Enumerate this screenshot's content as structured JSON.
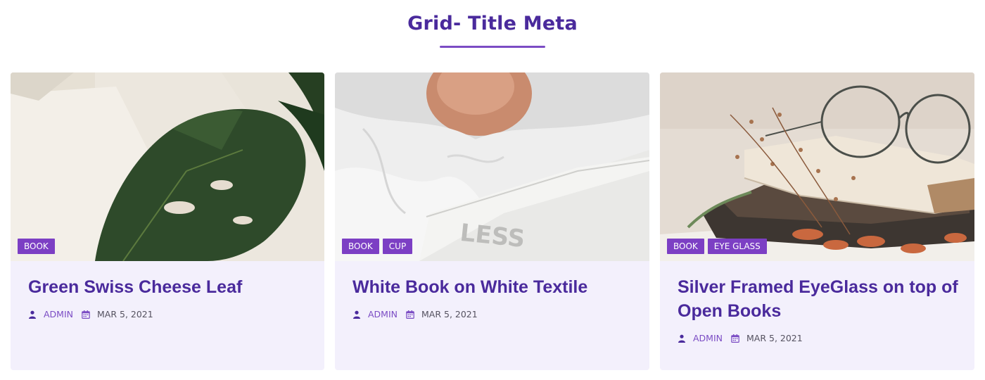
{
  "section": {
    "title": "Grid- Title Meta"
  },
  "colors": {
    "accent": "#7c3fc4",
    "title": "#4a2a9c",
    "card_bg": "#f3f0fc"
  },
  "cards": [
    {
      "image_icon": "monstera-leaf-photo",
      "tags": [
        "BOOK"
      ],
      "title": "Green Swiss Cheese Leaf",
      "author": "ADMIN",
      "date": "MAR 5, 2021",
      "author_icon": "user-icon",
      "date_icon": "calendar-icon"
    },
    {
      "image_icon": "white-book-photo",
      "image_text": "LESS",
      "tags": [
        "BOOK",
        "CUP"
      ],
      "title": "White Book on White Textile",
      "author": "ADMIN",
      "date": "MAR 5, 2021",
      "author_icon": "user-icon",
      "date_icon": "calendar-icon"
    },
    {
      "image_icon": "eyeglass-books-photo",
      "tags": [
        "BOOK",
        "EYE GLASS"
      ],
      "title": "Silver Framed EyeGlass on top of Open Books",
      "author": "ADMIN",
      "date": "MAR 5, 2021",
      "author_icon": "user-icon",
      "date_icon": "calendar-icon"
    }
  ]
}
